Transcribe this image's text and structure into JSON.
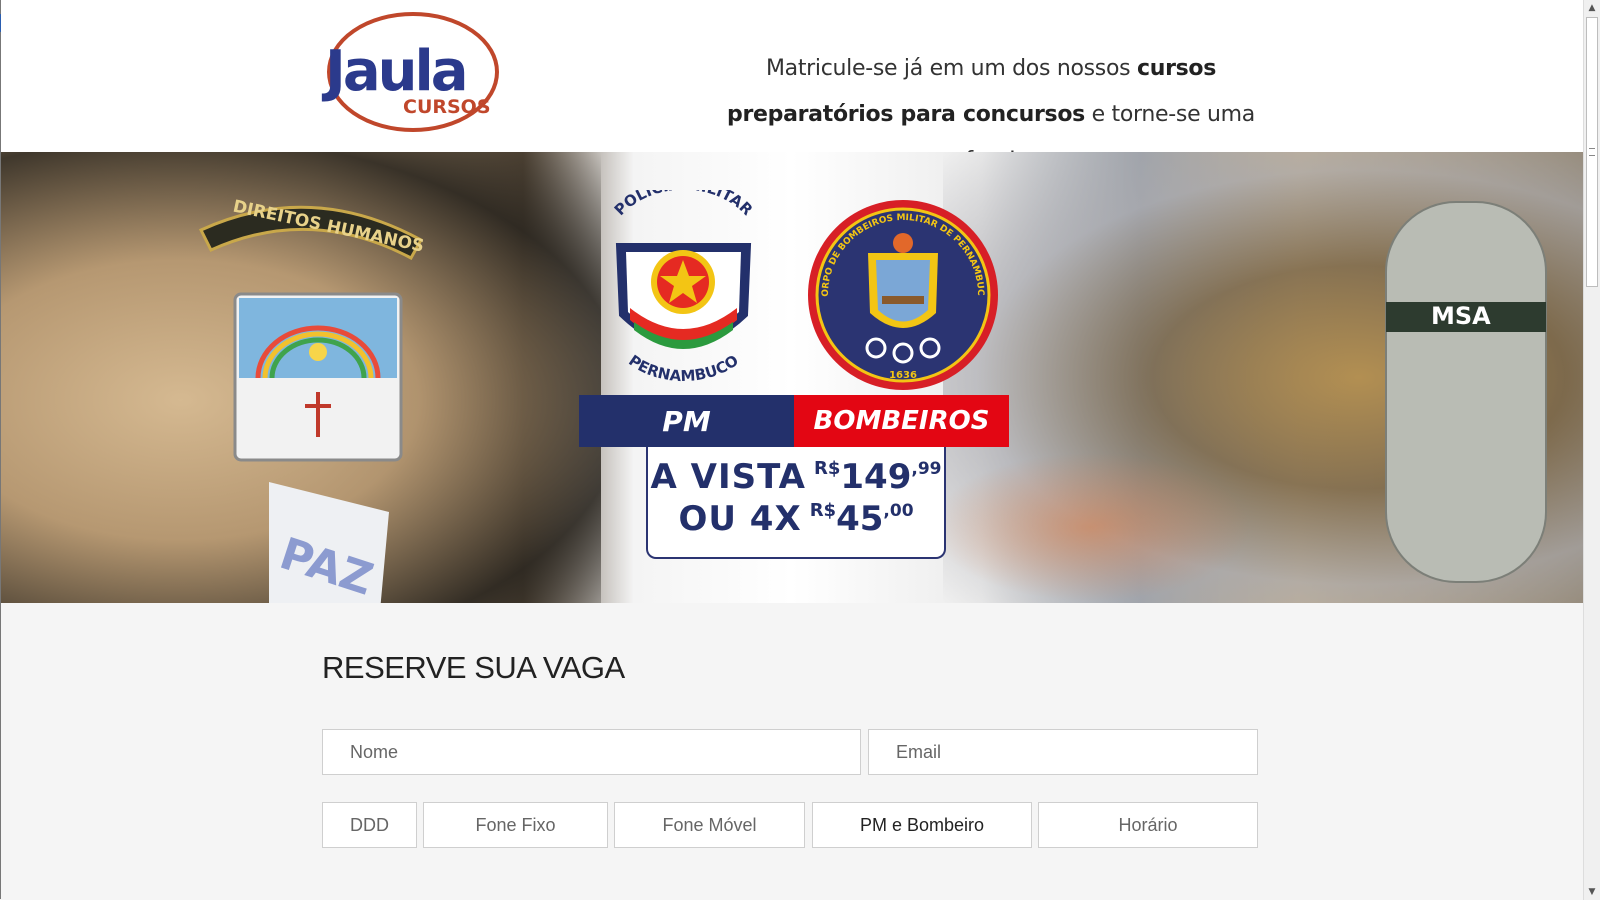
{
  "header": {
    "logo": {
      "name": "Jaula",
      "sub": "CURSOS"
    },
    "tagline": {
      "part1": "Matricule-se já em um dos nossos ",
      "bold1": "cursos",
      "bold2": "preparatórios para concursos",
      "part2": " e torne-se uma fera!"
    }
  },
  "hero": {
    "pm_emblem_top": "POLÍCIA MILITAR",
    "pm_emblem_bottom": "PERNAMBUCO",
    "bombeiros_emblem_text": "CORPO DE BOMBEIROS MILITAR DE PERNAMBUCO",
    "bombeiros_emblem_year": "1636",
    "patch_text": "DIREITOS HUMANOS",
    "armband_text": "PAZ",
    "tank_label": "MSA",
    "banner": {
      "pm": "PM",
      "bombeiros": "BOMBEIROS"
    },
    "price": {
      "line1_label": "A VISTA",
      "line1_currency": "R$",
      "line1_amount": "149",
      "line1_cents": ",99",
      "line2_label": "OU 4X",
      "line2_currency": "R$",
      "line2_amount": "45",
      "line2_cents": ",00"
    },
    "colors": {
      "navy": "#23306b",
      "red": "#e30613"
    }
  },
  "form": {
    "title": "RESERVE SUA VAGA",
    "nome_placeholder": "Nome",
    "email_placeholder": "Email",
    "ddd_placeholder": "DDD",
    "fone_fixo_placeholder": "Fone Fixo",
    "fone_movel_placeholder": "Fone Móvel",
    "curso_selected": "PM e Bombeiro",
    "horario_selected": "Horário"
  },
  "scrollbar": {
    "up_icon": "▲",
    "down_icon": "▼"
  }
}
